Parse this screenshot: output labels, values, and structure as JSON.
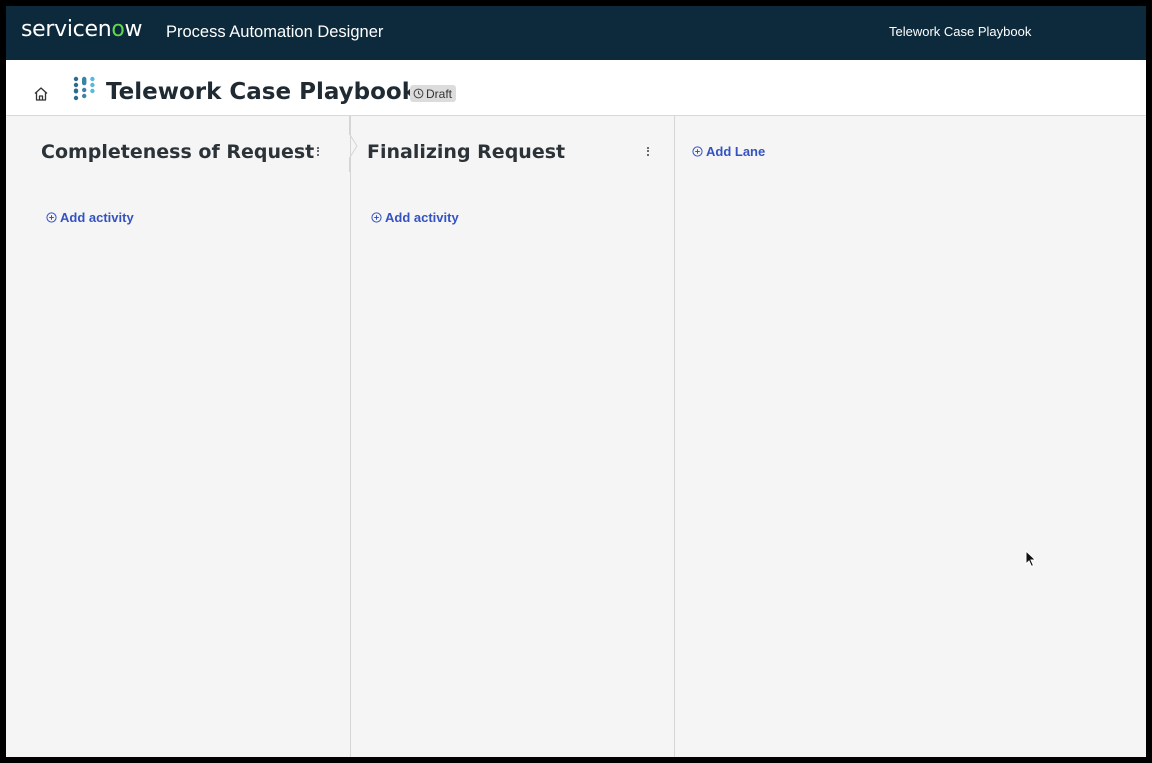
{
  "topbar": {
    "brand_left": "servicen",
    "brand_o": "o",
    "brand_right": "w",
    "app_name": "Process Automation Designer",
    "right_title": "Telework Case Playbook"
  },
  "header": {
    "title": "Telework Case Playbook",
    "status": "Draft",
    "home_icon": "home-icon",
    "playbook_icon": "playbook-icon"
  },
  "lanes": [
    {
      "title": "Completeness of Request",
      "add_label": "Add activity"
    },
    {
      "title": "Finalizing Request",
      "add_label": "Add activity"
    }
  ],
  "add_lane_label": "Add Lane",
  "colors": {
    "topbar": "#0c2a3b",
    "brand_accent": "#62d84e",
    "link": "#3453c0",
    "canvas": "#f5f5f5"
  }
}
